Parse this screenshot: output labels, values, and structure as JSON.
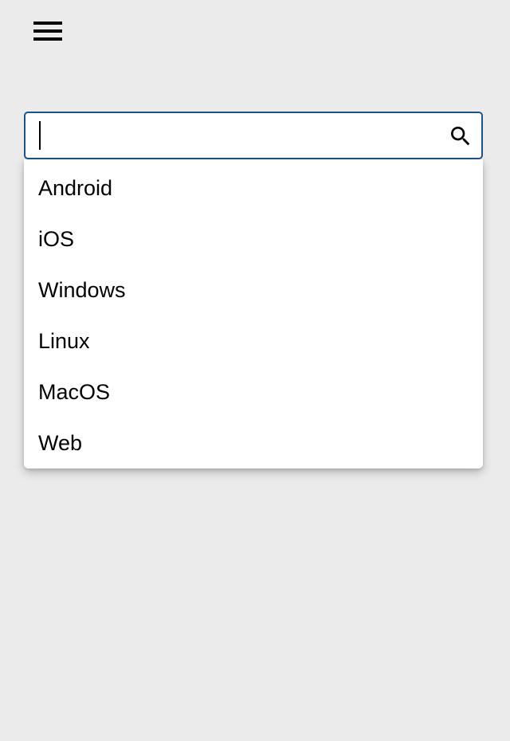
{
  "header": {
    "menu_icon": "hamburger-menu-icon"
  },
  "search": {
    "value": "",
    "placeholder": "",
    "icon": "search-icon",
    "border_color": "#1a5490"
  },
  "dropdown": {
    "items": [
      {
        "label": "Android"
      },
      {
        "label": "iOS"
      },
      {
        "label": "Windows"
      },
      {
        "label": "Linux"
      },
      {
        "label": "MacOS"
      },
      {
        "label": "Web"
      }
    ]
  }
}
